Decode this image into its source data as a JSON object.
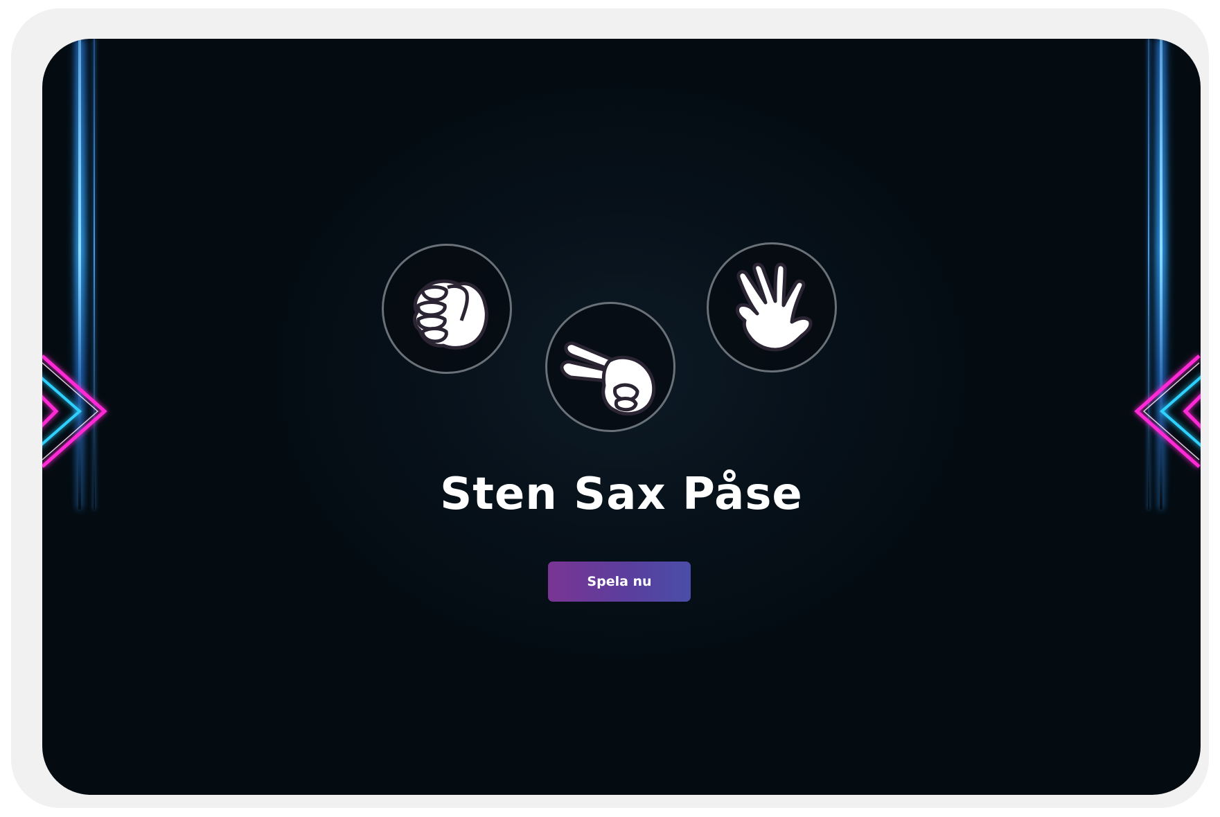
{
  "game": {
    "title": "Sten Sax Påse",
    "play_label": "Spela nu"
  },
  "choices": [
    {
      "name": "rock",
      "icon": "fist-icon"
    },
    {
      "name": "scissors",
      "icon": "peace-sign-icon"
    },
    {
      "name": "paper",
      "icon": "open-hand-icon"
    }
  ],
  "colors": {
    "background": "#040c12",
    "neon_blue": "#3aa8ff",
    "neon_pink": "#ff2bd6",
    "neon_cyan": "#2fd0ff",
    "ring": "#6a7178",
    "button_start": "#7a3593",
    "button_end": "#4a4ea8",
    "frame": "#f1f1f1"
  }
}
